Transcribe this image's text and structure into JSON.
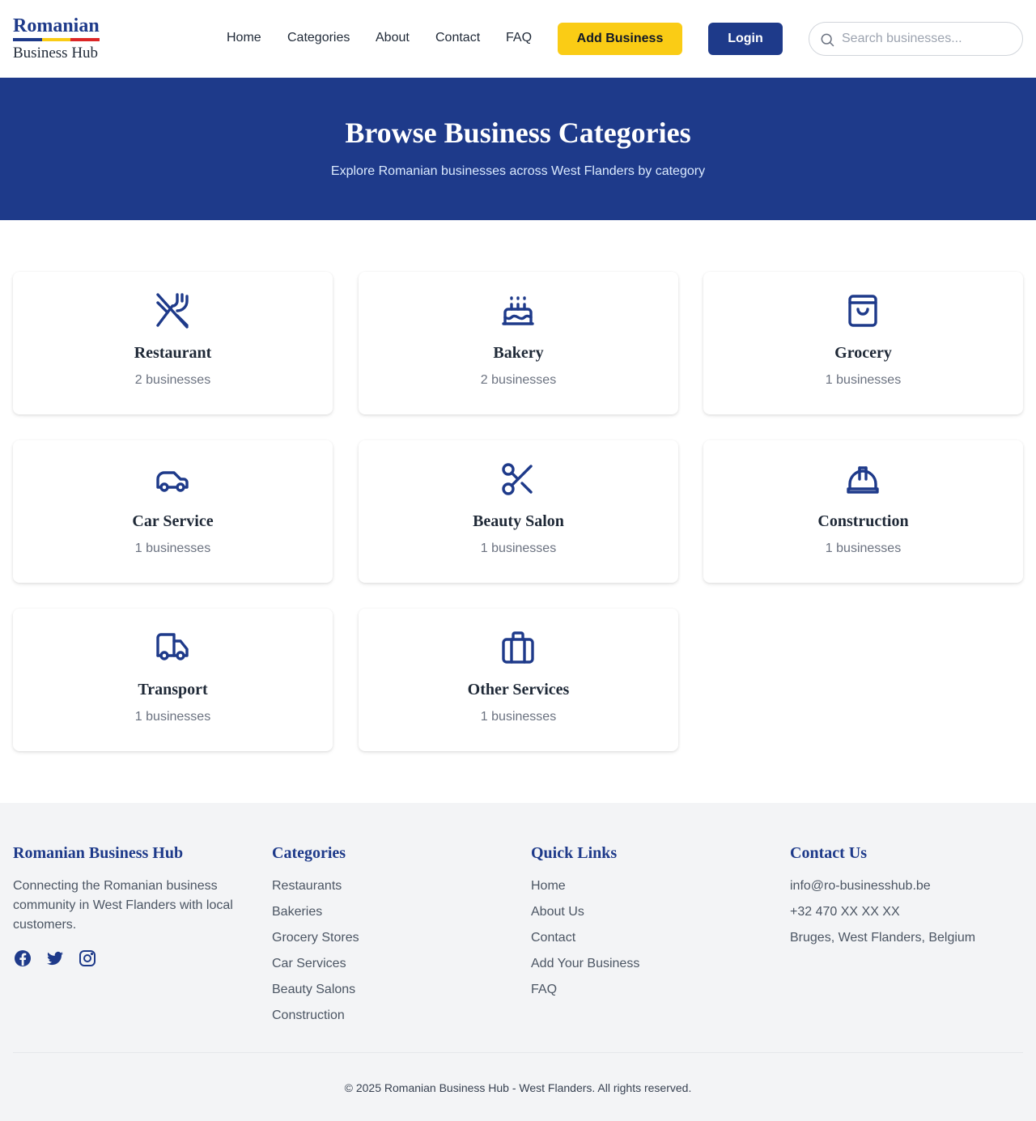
{
  "brand": {
    "title": "Romanian",
    "subtitle": "Business Hub",
    "flag_colors": [
      "#1e3a8a",
      "#facc15",
      "#dc2626"
    ]
  },
  "nav": {
    "links": [
      "Home",
      "Categories",
      "About",
      "Contact",
      "FAQ"
    ],
    "add_business": "Add Business",
    "login": "Login",
    "search_placeholder": "Search businesses..."
  },
  "hero": {
    "title": "Browse Business Categories",
    "subtitle": "Explore Romanian businesses across West Flanders by category"
  },
  "categories": [
    {
      "name": "Restaurant",
      "count": "2 businesses",
      "icon": "utensils-crossed-icon"
    },
    {
      "name": "Bakery",
      "count": "2 businesses",
      "icon": "cake-icon"
    },
    {
      "name": "Grocery",
      "count": "1 businesses",
      "icon": "shopping-bag-icon"
    },
    {
      "name": "Car Service",
      "count": "1 businesses",
      "icon": "car-icon"
    },
    {
      "name": "Beauty Salon",
      "count": "1 businesses",
      "icon": "scissors-icon"
    },
    {
      "name": "Construction",
      "count": "1 businesses",
      "icon": "hard-hat-icon"
    },
    {
      "name": "Transport",
      "count": "1 businesses",
      "icon": "truck-icon"
    },
    {
      "name": "Other Services",
      "count": "1 businesses",
      "icon": "briefcase-icon"
    }
  ],
  "footer": {
    "about": {
      "title": "Romanian Business Hub",
      "text": "Connecting the Romanian business community in West Flanders with local customers.",
      "social": [
        "facebook-icon",
        "twitter-icon",
        "instagram-icon"
      ]
    },
    "categories": {
      "title": "Categories",
      "items": [
        "Restaurants",
        "Bakeries",
        "Grocery Stores",
        "Car Services",
        "Beauty Salons",
        "Construction"
      ]
    },
    "quick_links": {
      "title": "Quick Links",
      "items": [
        "Home",
        "About Us",
        "Contact",
        "Add Your Business",
        "FAQ"
      ]
    },
    "contact": {
      "title": "Contact Us",
      "email": "info@ro-businesshub.be",
      "phone": "+32 470 XX XX XX",
      "address": "Bruges, West Flanders, Belgium"
    },
    "copyright": "© 2025 Romanian Business Hub - West Flanders. All rights reserved."
  },
  "colors": {
    "primary": "#1e3a8a",
    "accent": "#facc15",
    "footer_bg": "#f3f4f6"
  }
}
